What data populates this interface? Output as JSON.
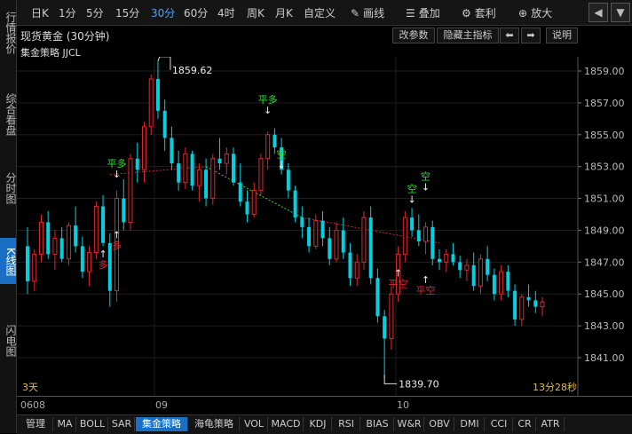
{
  "sidebar": {
    "tabs": [
      {
        "label": "行情报价",
        "active": false
      },
      {
        "label": "综合看盘",
        "active": false
      },
      {
        "label": "分时图",
        "active": false
      },
      {
        "label": "K线图",
        "active": true
      },
      {
        "label": "闪电图",
        "active": false
      }
    ]
  },
  "toolbar": {
    "periods": [
      "日K",
      "1分",
      "5分",
      "15分",
      "30分",
      "60分",
      "4时",
      "周K",
      "月K",
      "自定义"
    ],
    "active_period": "30分",
    "draw_label": "画线",
    "overlay_label": "叠加",
    "arbitrage_label": "套利",
    "zoom_label": "放大"
  },
  "titlebar": {
    "title": "现货黄金 (30分钟)",
    "modify_params": "改参数",
    "hide_indicator": "隐藏主指标",
    "help": "说明"
  },
  "strategy_label": "集金策略 JJCL",
  "chart_data": {
    "type": "candlestick",
    "instrument": "现货黄金",
    "period": "30分钟",
    "ylim": [
      1840,
      1860
    ],
    "y_ticks": [
      1859.0,
      1857.0,
      1855.0,
      1853.0,
      1851.0,
      1849.0,
      1847.0,
      1845.0,
      1843.0,
      1841.0
    ],
    "y_tick_labels": [
      "1859.00",
      "1857.00",
      "1855.00",
      "1853.00",
      "1851.00",
      "1849.00",
      "1847.00",
      "1845.00",
      "1843.00",
      "1841.00"
    ],
    "x_labels": [
      "0608",
      "09",
      "10"
    ],
    "high_label": "1859.62",
    "low_label": "1839.70",
    "up_color": "#e0282c",
    "down_color": "#00d0e0",
    "candles": [
      [
        1848.0,
        1849.2,
        1845.0,
        1845.8
      ],
      [
        1845.8,
        1847.8,
        1845.2,
        1847.5
      ],
      [
        1847.5,
        1850.0,
        1847.0,
        1849.5
      ],
      [
        1849.5,
        1850.2,
        1847.2,
        1847.5
      ],
      [
        1847.5,
        1849.0,
        1846.5,
        1848.5
      ],
      [
        1848.5,
        1849.2,
        1847.0,
        1847.2
      ],
      [
        1847.2,
        1849.5,
        1846.8,
        1849.3
      ],
      [
        1849.3,
        1850.5,
        1847.6,
        1848.0
      ],
      [
        1848.0,
        1848.6,
        1846.0,
        1846.4
      ],
      [
        1846.4,
        1848.0,
        1845.5,
        1847.6
      ],
      [
        1847.6,
        1850.8,
        1847.2,
        1850.5
      ],
      [
        1850.5,
        1851.2,
        1848.0,
        1848.2
      ],
      [
        1848.2,
        1848.8,
        1844.2,
        1845.2
      ],
      [
        1845.2,
        1851.5,
        1844.5,
        1851.0
      ],
      [
        1851.0,
        1852.2,
        1849.0,
        1849.5
      ],
      [
        1849.5,
        1853.8,
        1849.0,
        1853.5
      ],
      [
        1853.5,
        1854.5,
        1852.0,
        1852.8
      ],
      [
        1852.8,
        1855.8,
        1852.0,
        1855.5
      ],
      [
        1855.5,
        1858.8,
        1855.0,
        1858.5
      ],
      [
        1858.5,
        1859.62,
        1856.0,
        1856.5
      ],
      [
        1856.5,
        1857.2,
        1854.0,
        1854.8
      ],
      [
        1854.8,
        1855.5,
        1852.8,
        1853.2
      ],
      [
        1853.2,
        1854.0,
        1851.5,
        1852.0
      ],
      [
        1852.0,
        1854.2,
        1851.6,
        1853.8
      ],
      [
        1853.8,
        1854.0,
        1851.5,
        1851.8
      ],
      [
        1851.8,
        1853.2,
        1850.8,
        1852.8
      ],
      [
        1852.8,
        1853.5,
        1850.5,
        1851.0
      ],
      [
        1851.0,
        1853.8,
        1850.6,
        1853.5
      ],
      [
        1853.5,
        1854.8,
        1852.8,
        1853.2
      ],
      [
        1853.2,
        1854.2,
        1852.5,
        1853.8
      ],
      [
        1853.8,
        1854.2,
        1851.8,
        1852.0
      ],
      [
        1852.0,
        1853.2,
        1850.5,
        1850.8
      ],
      [
        1850.8,
        1851.5,
        1849.5,
        1850.0
      ],
      [
        1850.0,
        1852.0,
        1849.8,
        1851.5
      ],
      [
        1851.5,
        1853.8,
        1851.2,
        1853.5
      ],
      [
        1853.5,
        1855.2,
        1852.8,
        1855.0
      ],
      [
        1855.0,
        1855.4,
        1853.8,
        1854.2
      ],
      [
        1854.2,
        1854.8,
        1852.5,
        1852.8
      ],
      [
        1852.8,
        1853.2,
        1851.0,
        1851.5
      ],
      [
        1851.5,
        1851.8,
        1849.5,
        1849.8
      ],
      [
        1849.8,
        1850.5,
        1848.5,
        1849.2
      ],
      [
        1849.2,
        1849.8,
        1847.6,
        1848.0
      ],
      [
        1848.0,
        1850.0,
        1847.8,
        1849.6
      ],
      [
        1849.6,
        1850.2,
        1848.0,
        1848.5
      ],
      [
        1848.5,
        1849.2,
        1846.8,
        1847.2
      ],
      [
        1847.2,
        1849.5,
        1847.0,
        1849.0
      ],
      [
        1849.0,
        1849.8,
        1847.2,
        1847.6
      ],
      [
        1847.6,
        1848.2,
        1845.5,
        1846.0
      ],
      [
        1846.0,
        1847.5,
        1845.5,
        1847.0
      ],
      [
        1847.0,
        1850.2,
        1846.5,
        1849.8
      ],
      [
        1849.8,
        1850.5,
        1845.6,
        1846.0
      ],
      [
        1846.0,
        1846.6,
        1843.2,
        1843.6
      ],
      [
        1843.6,
        1844.0,
        1839.7,
        1842.2
      ],
      [
        1842.2,
        1845.5,
        1841.5,
        1845.0
      ],
      [
        1845.0,
        1848.0,
        1844.5,
        1847.5
      ],
      [
        1847.5,
        1850.2,
        1847.0,
        1849.8
      ],
      [
        1849.8,
        1850.4,
        1848.6,
        1849.0
      ],
      [
        1849.0,
        1850.0,
        1848.0,
        1848.3
      ],
      [
        1848.3,
        1849.5,
        1847.5,
        1849.2
      ],
      [
        1849.2,
        1849.6,
        1846.8,
        1847.2
      ],
      [
        1847.2,
        1847.8,
        1846.5,
        1847.0
      ],
      [
        1847.0,
        1847.8,
        1846.4,
        1847.5
      ],
      [
        1847.5,
        1848.2,
        1846.8,
        1847.0
      ],
      [
        1847.0,
        1847.4,
        1846.0,
        1846.5
      ],
      [
        1846.5,
        1847.2,
        1845.8,
        1846.8
      ],
      [
        1846.8,
        1847.6,
        1845.2,
        1845.5
      ],
      [
        1845.5,
        1847.5,
        1845.0,
        1847.2
      ],
      [
        1847.2,
        1848.0,
        1845.8,
        1846.2
      ],
      [
        1846.2,
        1846.6,
        1844.6,
        1845.0
      ],
      [
        1845.0,
        1846.8,
        1844.6,
        1846.4
      ],
      [
        1846.4,
        1846.8,
        1844.8,
        1845.2
      ],
      [
        1845.2,
        1845.6,
        1843.0,
        1843.4
      ],
      [
        1843.4,
        1845.0,
        1843.0,
        1844.8
      ],
      [
        1844.8,
        1845.6,
        1844.2,
        1844.6
      ],
      [
        1844.6,
        1845.2,
        1843.8,
        1844.2
      ],
      [
        1844.2,
        1844.8,
        1843.6,
        1844.5
      ]
    ],
    "trend_line": [
      [
        12,
        1852.5
      ],
      [
        26,
        1853.0
      ],
      [
        40,
        1849.8
      ],
      [
        60,
        1848.2
      ]
    ],
    "signals": [
      {
        "label": "平多",
        "index": 13,
        "price": 1852.2,
        "color": "#2fe02f",
        "position": "above"
      },
      {
        "label": "多",
        "index": 13,
        "price": 1848.6,
        "color": "#e0282c",
        "position": "below"
      },
      {
        "label": "多",
        "index": 11,
        "price": 1847.4,
        "color": "#e0282c",
        "position": "below"
      },
      {
        "label": "平多",
        "index": 35,
        "price": 1856.2,
        "color": "#2fe02f",
        "position": "above"
      },
      {
        "label": "空",
        "index": 37,
        "price": 1852.8,
        "color": "#2fe02f",
        "position": "above"
      },
      {
        "label": "空",
        "index": 56,
        "price": 1850.6,
        "color": "#2fe02f",
        "position": "above"
      },
      {
        "label": "空",
        "index": 58,
        "price": 1851.4,
        "color": "#2fe02f",
        "position": "above"
      },
      {
        "label": "平空",
        "index": 54,
        "price": 1846.2,
        "color": "#e0282c",
        "position": "below"
      },
      {
        "label": "平空",
        "index": 58,
        "price": 1845.8,
        "color": "#e0282c",
        "position": "below"
      }
    ]
  },
  "status": {
    "days": "3天",
    "countdown": "13分28秒"
  },
  "bottom_tabs": [
    "管理",
    "MA",
    "BOLL",
    "SAR",
    "集金策略",
    "海龟策略",
    "VOL",
    "MACD",
    "KDJ",
    "RSI",
    "BIAS",
    "W&R",
    "OBV",
    "DMI",
    "CCI",
    "CR",
    "ATR"
  ],
  "active_bottom_tab": "集金策略"
}
